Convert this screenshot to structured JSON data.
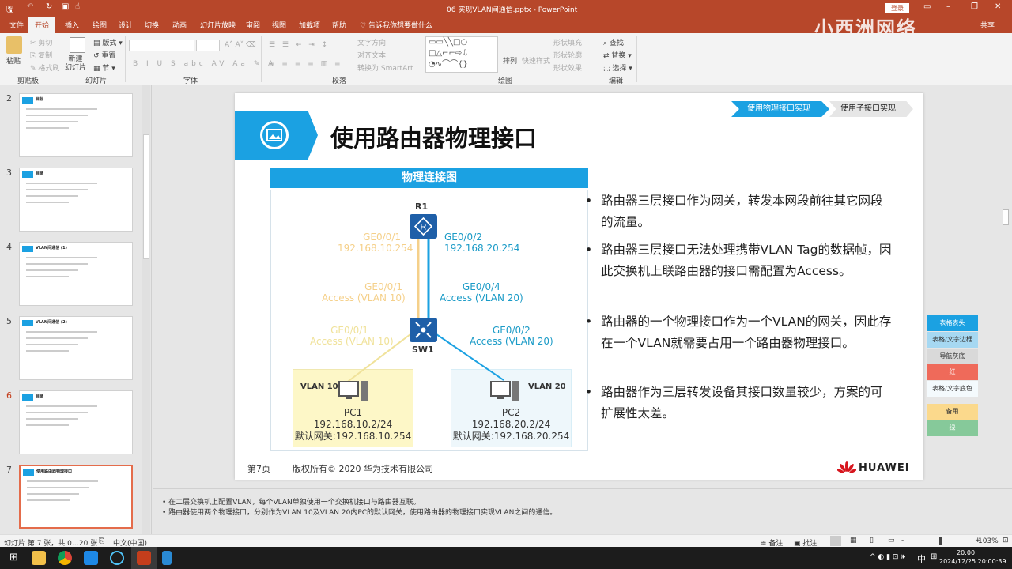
{
  "titlebar": {
    "title": "06 实现VLAN间通信.pptx  -  PowerPoint",
    "login": "登录",
    "min": "–",
    "restore": "❐",
    "close": "✕",
    "share": "共享",
    "watermark": "小西洲网络"
  },
  "tabs": [
    "文件",
    "开始",
    "插入",
    "绘图",
    "设计",
    "切换",
    "动画",
    "幻灯片放映",
    "审阅",
    "视图",
    "加载项",
    "帮助"
  ],
  "tellme": "告诉我你想要做什么",
  "ribbon": {
    "clipboard": {
      "paste": "粘贴",
      "cut": "剪切",
      "copy": "复制",
      "format_painter": "格式刷",
      "label": "剪贴板"
    },
    "slides": {
      "new_slide": "新建\n幻灯片",
      "layout": "版式",
      "reset": "重置",
      "section": "节",
      "label": "幻灯片"
    },
    "font": {
      "label": "字体"
    },
    "paragraph": {
      "text_direction": "文字方向",
      "align_text": "对齐文本",
      "smartart": "转换为 SmartArt",
      "label": "段落"
    },
    "drawing": {
      "arrange": "排列",
      "quick_styles": "快速样式",
      "fill": "形状填充",
      "outline": "形状轮廓",
      "effects": "形状效果",
      "label": "绘图"
    },
    "editing": {
      "find": "查找",
      "replace": "替换",
      "select": "选择",
      "label": "编辑"
    }
  },
  "thumbnails": [
    {
      "num": "2",
      "title": "目标"
    },
    {
      "num": "3",
      "title": "目录"
    },
    {
      "num": "4",
      "title": "VLAN间通信 (1)"
    },
    {
      "num": "5",
      "title": "VLAN间通信 (2)"
    },
    {
      "num": "6",
      "title": "目录"
    },
    {
      "num": "7",
      "title": "使用路由器物理接口"
    }
  ],
  "slide": {
    "breadcrumb": [
      "使用物理接口实现",
      "使用子接口实现"
    ],
    "title": "使用路由器物理接口",
    "diagram_title": "物理连接图",
    "r1": "R1",
    "sw1": "SW1",
    "r1_left": [
      "GE0/0/1",
      "192.168.10.254"
    ],
    "r1_right": [
      "GE0/0/2",
      "192.168.20.254"
    ],
    "sw_up_left": [
      "GE0/0/1",
      "Access (VLAN 10)"
    ],
    "sw_up_right": [
      "GE0/0/4",
      "Access (VLAN 20)"
    ],
    "sw_down_left": [
      "GE0/0/1",
      "Access (VLAN 10)"
    ],
    "sw_down_right": [
      "GE0/0/2",
      "Access (VLAN 20)"
    ],
    "pc1": {
      "vlan": "VLAN 10",
      "name": "PC1",
      "ip": "192.168.10.2/24",
      "gw": "默认网关:192.168.10.254"
    },
    "pc2": {
      "vlan": "VLAN 20",
      "name": "PC2",
      "ip": "192.168.20.2/24",
      "gw": "默认网关:192.168.20.254"
    },
    "bullets": [
      "路由器三层接口作为网关，转发本网段前往其它网段的流量。",
      "路由器三层接口无法处理携带VLAN Tag的数据帧，因此交换机上联路由器的接口需配置为Access。",
      "路由器的一个物理接口作为一个VLAN的网关，因此存在一个VLAN就需要占用一个路由器物理接口。",
      "路由器作为三层转发设备其接口数量较少，方案的可扩展性太差。"
    ],
    "page": "第7页",
    "copyright": "版权所有© 2020 华为技术有限公司",
    "logo": "HUAWEI"
  },
  "swatches": [
    {
      "label": "表格表头",
      "bg": "#1ba1e2",
      "fg": "#ffffff"
    },
    {
      "label": "表格/文字边框",
      "bg": "#a6d8f2",
      "fg": "#333333"
    },
    {
      "label": "导航灰底",
      "bg": "#d9d9d9",
      "fg": "#333333"
    },
    {
      "label": "红",
      "bg": "#ef6a5a",
      "fg": "#ffffff"
    },
    {
      "label": "表格/文字底色",
      "bg": "#f4fafd",
      "fg": "#333333"
    },
    {
      "label": "备用",
      "bg": "#fbd98c",
      "fg": "#333333"
    },
    {
      "label": "绿",
      "bg": "#86c99a",
      "fg": "#ffffff"
    }
  ],
  "notes": [
    "在二层交换机上配置VLAN，每个VLAN单独使用一个交换机接口与路由器互联。",
    "路由器使用两个物理接口，分别作为VLAN 10及VLAN 20内PC的默认网关，使用路由器的物理接口实现VLAN之间的通信。"
  ],
  "status": {
    "slide_info": "幻灯片 第 7 张，共 0…20 张",
    "language": "中文(中国)",
    "notes": "备注",
    "comments": "批注",
    "zoom": "103%"
  },
  "taskbar": {
    "time": "20:00",
    "date": "2024/12/25 20:00:39",
    "ime": "中"
  }
}
